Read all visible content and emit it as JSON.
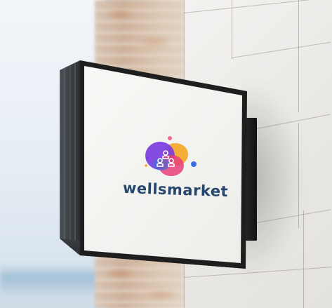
{
  "sign": {
    "brand_name": "wellsmarket",
    "logo_icon": "people-group-icon"
  },
  "colors": {
    "sign_face": "#f6f6f4",
    "sign_frame": "#1e1e1e",
    "brand_text": "#24476b",
    "blob_purple": "#7a3de0",
    "blob_orange": "#f5a623",
    "blob_pink": "#e8417a",
    "accent_blue": "#3b6fe0"
  }
}
